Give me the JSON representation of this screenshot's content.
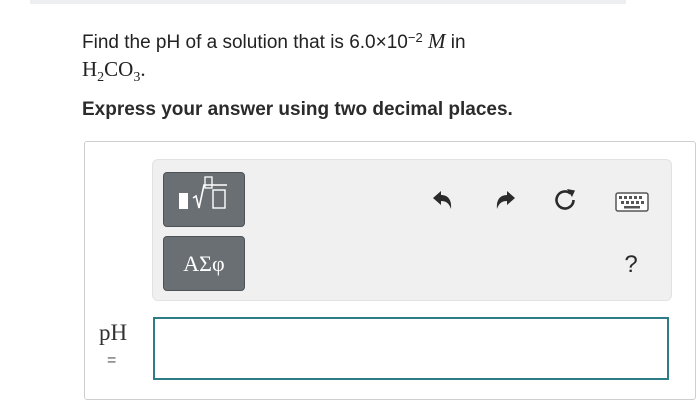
{
  "question": {
    "prefix": "Find the pH of a solution that is 6.0×10",
    "exponent": "−2",
    "unit": "M",
    "suffix": " in",
    "compound_h": "H",
    "compound_h_sub": "2",
    "compound_co": "CO",
    "compound_co_sub": "3",
    "period": "."
  },
  "instruction": "Express your answer using two decimal places.",
  "toolbar": {
    "templates_icon": "templates-icon",
    "greek_label": "ΑΣφ",
    "undo_icon": "undo-arrow-icon",
    "redo_icon": "redo-arrow-icon",
    "reset_icon": "reset-icon",
    "keyboard_icon": "keyboard-icon",
    "help_label": "?"
  },
  "answer": {
    "variable_label": "pH",
    "equals_label": "=",
    "value": ""
  },
  "colors": {
    "button_bg": "#6a6f73",
    "input_border": "#2e7d86",
    "toolbar_bg": "#f0f0f0"
  }
}
